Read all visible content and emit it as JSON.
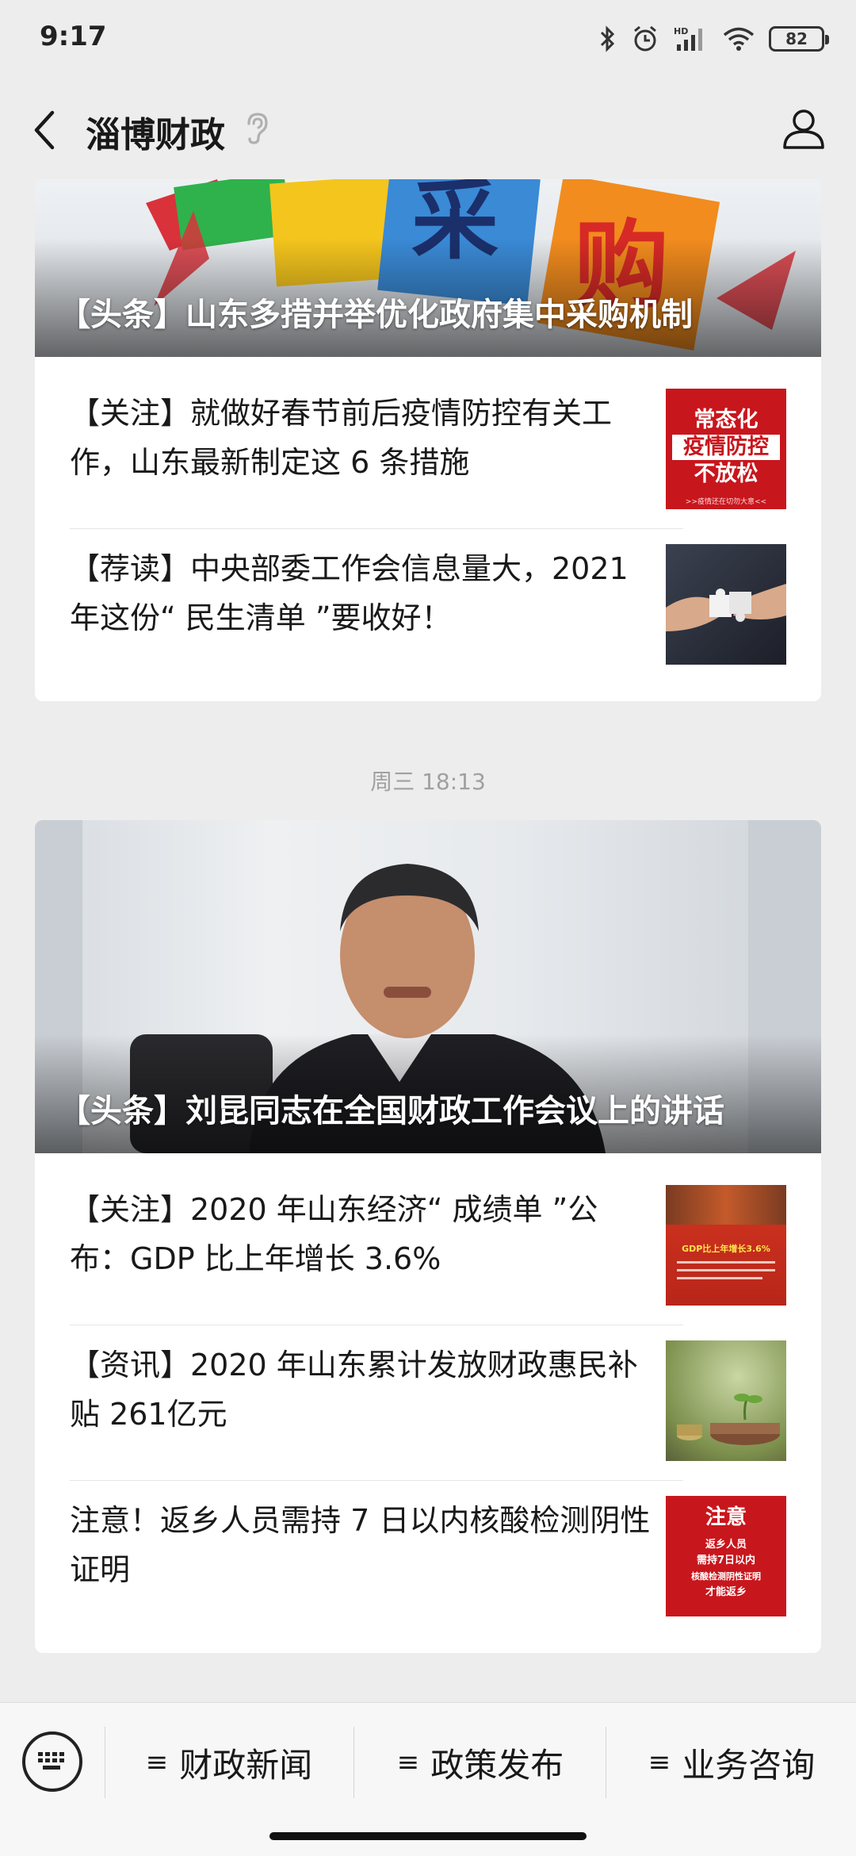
{
  "status_bar": {
    "time": "9:17",
    "battery": "82"
  },
  "nav": {
    "title": "淄博财政"
  },
  "groups": [
    {
      "cover": {
        "title": "【头条】山东多措并举优化政府集中采购机制",
        "image": "procurement-blocks-image"
      },
      "items": [
        {
          "text": "【关注】就做好春节前后疫情防控有关工作，山东最新制定这 6 条措施",
          "thumb": {
            "line1": "常态化",
            "line2": "疫情防控",
            "line3": "不放松",
            "foot": ">>疫情还在切勿大意<<"
          }
        },
        {
          "text": "【荐读】中央部委工作会信息量大，2021 年这份“ 民生清单 ”要收好！",
          "thumb": {
            "name": "puzzle-hands-image"
          }
        }
      ]
    },
    {
      "timestamp": "周三 18:13",
      "cover": {
        "title": "【头条】刘昆同志在全国财政工作会议上的讲话",
        "image": "speaker-photo"
      },
      "items": [
        {
          "text": "【关注】2020 年山东经济“ 成绩单 ”公布：GDP 比上年增长 3.6%",
          "thumb": {
            "line1": "GDP比上年增长3.6%"
          }
        },
        {
          "text": "【资讯】2020 年山东累计发放财政惠民补贴 261亿元",
          "thumb": {
            "name": "coins-plant-image"
          }
        },
        {
          "text": "注意！返乡人员需持 7 日以内核酸检测阴性证明",
          "thumb": {
            "line1": "注意",
            "line2": "返乡人员",
            "line3": "需持7日以内",
            "line4": "核酸检测阴性证明",
            "line5": "才能返乡"
          }
        }
      ]
    }
  ],
  "bottom_menu": {
    "items": [
      {
        "label": "财政新闻"
      },
      {
        "label": "政策发布"
      },
      {
        "label": "业务咨询"
      }
    ]
  },
  "colors": {
    "background": "#ededed",
    "card": "#ffffff",
    "text": "#191919",
    "timestamp": "#a0a0a0",
    "alert_red": "#c8161d"
  }
}
